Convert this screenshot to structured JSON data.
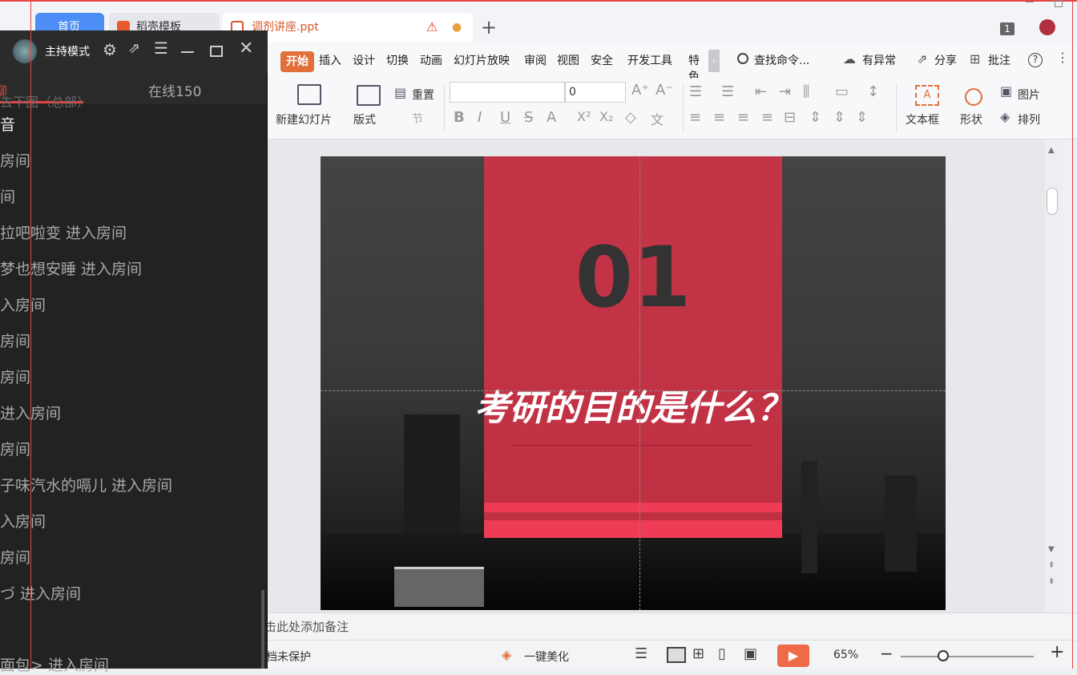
{
  "tabs": {
    "home": "首页",
    "template": "稻壳模板",
    "doc": "调剂讲座.ppt"
  },
  "menu": [
    "开始",
    "插入",
    "设计",
    "切换",
    "动画",
    "幻灯片放映",
    "审阅",
    "视图",
    "安全",
    "开发工具",
    "特色"
  ],
  "search": {
    "label": "查找命令..."
  },
  "menu_right": {
    "abnormal": "有异常",
    "share": "分享",
    "comment": "批注",
    "tab_count": "1"
  },
  "ribbon": {
    "new_slide": "新建幻灯片",
    "layout": "版式",
    "reset": "重置",
    "section": "节",
    "font_size": "0",
    "textbox": "文本框",
    "shape": "形状",
    "picture": "图片",
    "arrange": "排列"
  },
  "slide": {
    "number": "01",
    "title": "考研的目的是什么？"
  },
  "notes": {
    "placeholder": "击此处添加备注"
  },
  "status": {
    "protect": "档未保护",
    "beautify": "一键美化",
    "zoom": "65%"
  },
  "host": {
    "title": "主持模式",
    "tab_chat": "聊",
    "tab_online": "在线150",
    "messages": [
      "去下图（总部）",
      "音",
      "房间",
      "间",
      "拉吧啦变 进入房间",
      "梦也想安睡 进入房间",
      "入房间",
      "房间",
      "房间",
      "进入房间",
      "房间",
      "子味汽水的嗝儿 进入房间",
      "入房间",
      "房间",
      "づ 进入房间",
      "面包>    进入房间"
    ]
  }
}
